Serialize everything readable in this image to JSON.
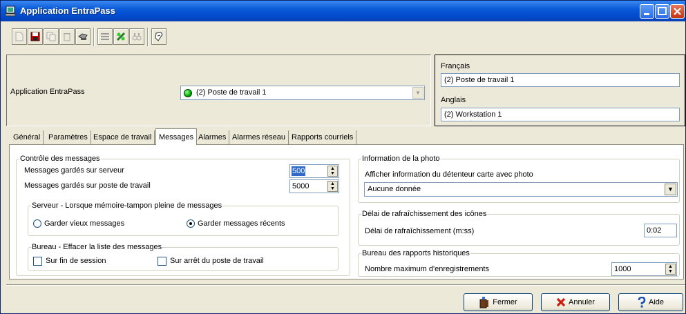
{
  "window": {
    "title": "Application EntraPass"
  },
  "header": {
    "label": "Application EntraPass",
    "selected_application": "(2)  Poste de travail 1",
    "french_label": "Français",
    "french_value": "(2)  Poste de travail 1",
    "english_label": "Anglais",
    "english_value": "(2)  Workstation 1"
  },
  "tabs": [
    "Général",
    "Paramètres",
    "Espace de travail",
    "Messages",
    "Alarmes",
    "Alarmes réseau",
    "Rapports courriels"
  ],
  "messages": {
    "control": {
      "legend": "Contrôle des messages",
      "server_label": "Messages gardés sur serveur",
      "server_value": "500",
      "workstation_label": "Messages gardés sur poste de travail",
      "workstation_value": "5000"
    },
    "server_buffer": {
      "legend": "Serveur - Lorsque mémoire-tampon pleine de messages",
      "keep_old": "Garder vieux messages",
      "keep_recent": "Garder messages récents",
      "selected": "keep_recent"
    },
    "desktop_clear": {
      "legend": "Bureau - Effacer la liste des messages",
      "on_logout": "Sur fin de session",
      "on_shutdown": "Sur arrêt du poste de travail"
    },
    "photo": {
      "legend": "Information de la photo",
      "label": "Afficher information du détenteur carte avec photo",
      "value": "Aucune donnée"
    },
    "icon_refresh": {
      "legend": "Délai de rafraîchissement des icônes",
      "label": "Délai de rafraîchissement (m:ss)",
      "value": "0:02"
    },
    "history": {
      "legend": "Bureau des rapports historiques",
      "label": "Nombre maximum d'enregistrements",
      "value": "1000"
    }
  },
  "buttons": {
    "close": "Fermer",
    "cancel": "Annuler",
    "help": "Aide"
  },
  "colors": {
    "title_bar": "#0a5ad8",
    "selection": "#316ac5",
    "status_green": "#00aa00"
  }
}
